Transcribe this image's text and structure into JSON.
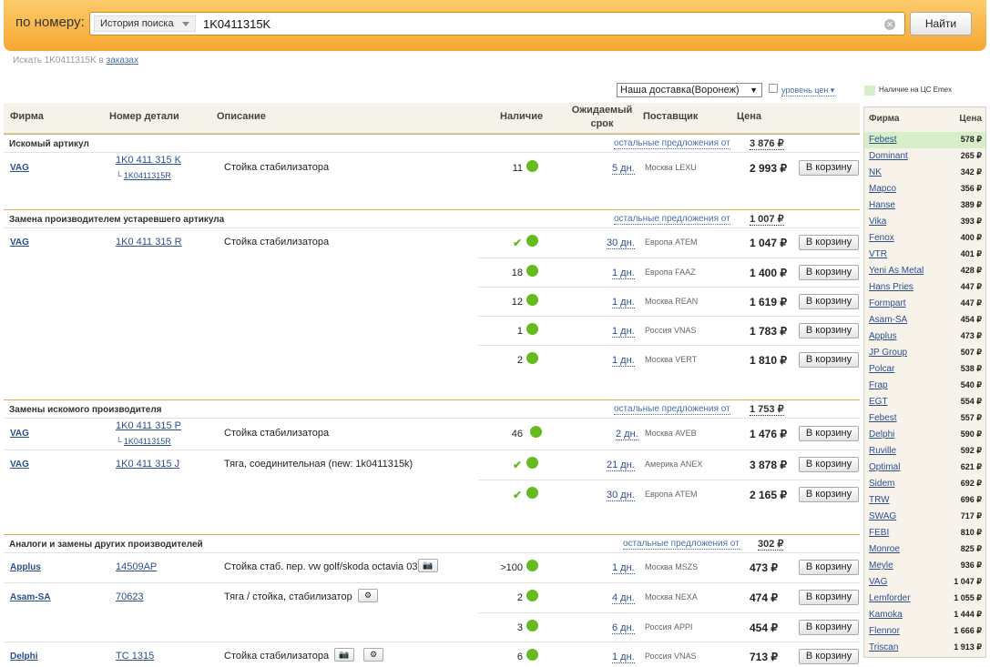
{
  "search": {
    "label": "по номеру:",
    "history": "История поиска",
    "query": "1K0411315K",
    "find_button": "Найти",
    "orders_prefix": "Искать 1K0411315K в",
    "orders_link": "заказах"
  },
  "filters": {
    "delivery": "Наша доставка(Воронеж)",
    "price_level": "уровень цен",
    "legend": "Наличие на ЦС Emex"
  },
  "columns": {
    "firm": "Фирма",
    "part": "Номер детали",
    "desc": "Описание",
    "stock": "Наличие",
    "term": "Ожидаемый срок",
    "supplier": "Поставщик",
    "price": "Цена"
  },
  "sections": [
    {
      "title": "Искомый артикул",
      "others": "остальные предложения от",
      "price": "3 876 ₽"
    },
    {
      "title": "Замена производителем устаревшего артикула",
      "others": "остальные предложения от",
      "price": "1 007 ₽"
    },
    {
      "title": "Замены искомого производителя",
      "others": "остальные предложения от",
      "price": "1 753 ₽"
    },
    {
      "title": "Аналоги и замены других производителей",
      "others": "остальные предложения от",
      "price": "302 ₽"
    }
  ],
  "rows": [
    {
      "brand": "VAG",
      "part": "1K0 411 315 K",
      "sub": "1K0411315R",
      "desc": "Стойка стабилизатора",
      "qty": "11",
      "term": "5 дн.",
      "supplier": "Москва LEXU",
      "price": "2 993 ₽",
      "cart": "В корзину"
    },
    {
      "brand": "VAG",
      "part": "1K0 411 315 R",
      "desc": "Стойка стабилизатора",
      "qty": "",
      "term": "30 дн.",
      "supplier": "Европа ATEM",
      "price": "1 047 ₽",
      "cart": "В корзину"
    },
    {
      "qty": "18",
      "term": "1 дн.",
      "supplier": "Европа FAAZ",
      "price": "1 400 ₽",
      "cart": "В корзину"
    },
    {
      "qty": "12",
      "term": "1 дн.",
      "supplier": "Москва REAN",
      "price": "1 619 ₽",
      "cart": "В корзину"
    },
    {
      "qty": "1",
      "term": "1 дн.",
      "supplier": "Россия VNAS",
      "price": "1 783 ₽",
      "cart": "В корзину"
    },
    {
      "qty": "2",
      "term": "1 дн.",
      "supplier": "Москва VERT",
      "price": "1 810 ₽",
      "cart": "В корзину"
    },
    {
      "brand": "VAG",
      "part": "1K0 411 315 P",
      "sub": "1K0411315R",
      "desc": "Стойка стабилизатора",
      "qty": "46",
      "term": "2 дн.",
      "supplier": "Москва AVEB",
      "price": "1 476 ₽",
      "cart": "В корзину"
    },
    {
      "brand": "VAG",
      "part": "1K0 411 315 J",
      "desc": "Тяга, соединительная (new: 1k0411315k)",
      "qty": "",
      "term": "21 дн.",
      "supplier": "Америка ANEX",
      "price": "3 878 ₽",
      "cart": "В корзину"
    },
    {
      "qty": "",
      "term": "30 дн.",
      "supplier": "Европа ATEM",
      "price": "2 165 ₽",
      "cart": "В корзину"
    },
    {
      "brand": "Applus",
      "part": "14509AP",
      "desc": "Стойка стаб. пер. vw golf/skoda octavia 03",
      "qty": ">100",
      "term": "1 дн.",
      "supplier": "Москва MSZS",
      "price": "473 ₽",
      "cart": "В корзину"
    },
    {
      "brand": "Asam-SA",
      "part": "70623",
      "desc": "Тяга / стойка, стабилизатор",
      "qty": "2",
      "term": "4 дн.",
      "supplier": "Москва NEXA",
      "price": "474 ₽",
      "cart": "В корзину"
    },
    {
      "qty": "3",
      "term": "6 дн.",
      "supplier": "Россия APPI",
      "price": "454 ₽",
      "cart": "В корзину"
    },
    {
      "brand": "Delphi",
      "part": "TC 1315",
      "desc": "Стойка стабилизатора",
      "qty": "6",
      "term": "1 дн.",
      "supplier": "Россия VNAS",
      "price": "713 ₽",
      "cart": "В корзину"
    }
  ],
  "sidebar": {
    "firm_header": "Фирма",
    "price_header": "Цена",
    "items": [
      {
        "name": "Febest",
        "price": "578 ₽"
      },
      {
        "name": "Dominant",
        "price": "265 ₽"
      },
      {
        "name": "NK",
        "price": "342 ₽"
      },
      {
        "name": "Mapco",
        "price": "356 ₽"
      },
      {
        "name": "Hanse",
        "price": "389 ₽"
      },
      {
        "name": "Vika",
        "price": "393 ₽"
      },
      {
        "name": "Fenox",
        "price": "400 ₽"
      },
      {
        "name": "VTR",
        "price": "401 ₽"
      },
      {
        "name": "Yeni As Metal",
        "price": "428 ₽"
      },
      {
        "name": "Hans Pries",
        "price": "447 ₽"
      },
      {
        "name": "Formpart",
        "price": "447 ₽"
      },
      {
        "name": "Asam-SA",
        "price": "454 ₽"
      },
      {
        "name": "Applus",
        "price": "473 ₽"
      },
      {
        "name": "JP Group",
        "price": "507 ₽"
      },
      {
        "name": "Polcar",
        "price": "538 ₽"
      },
      {
        "name": "Frap",
        "price": "540 ₽"
      },
      {
        "name": "EGT",
        "price": "554 ₽"
      },
      {
        "name": "Febest",
        "price": "557 ₽"
      },
      {
        "name": "Delphi",
        "price": "590 ₽"
      },
      {
        "name": "Ruville",
        "price": "592 ₽"
      },
      {
        "name": "Optimal",
        "price": "621 ₽"
      },
      {
        "name": "Sidem",
        "price": "692 ₽"
      },
      {
        "name": "TRW",
        "price": "696 ₽"
      },
      {
        "name": "SWAG",
        "price": "717 ₽"
      },
      {
        "name": "FEBI",
        "price": "810 ₽"
      },
      {
        "name": "Monroe",
        "price": "825 ₽"
      },
      {
        "name": "Meyle",
        "price": "936 ₽"
      },
      {
        "name": "VAG",
        "price": "1 047 ₽"
      },
      {
        "name": "Lemforder",
        "price": "1 055 ₽"
      },
      {
        "name": "Kamoka",
        "price": "1 444 ₽"
      },
      {
        "name": "Flennor",
        "price": "1 666 ₽"
      },
      {
        "name": "Triscan",
        "price": "1 913 ₽"
      }
    ]
  },
  "colors": {
    "accent": "#f6a730",
    "link": "#2c4f8c",
    "stock_green": "#66bb1f",
    "highlight": "#d6efc8"
  }
}
